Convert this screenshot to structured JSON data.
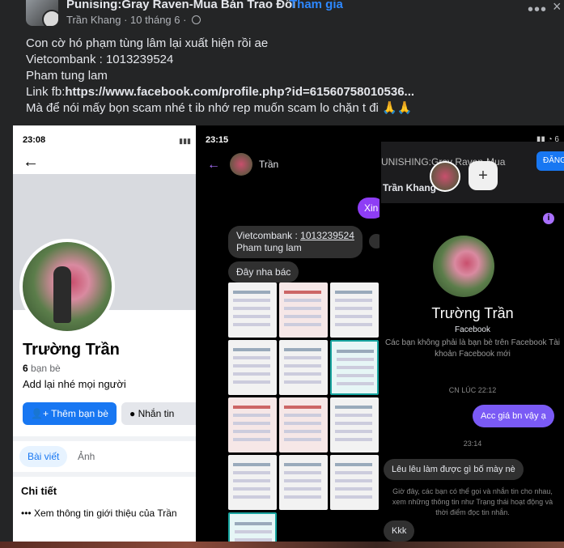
{
  "post": {
    "group_name": "Punising:Gray Raven-Mua Bán Trao Đổi",
    "separator": "·",
    "join_label": "Tham gia",
    "author": "Trần Khang",
    "date": "10 tháng 6",
    "meta_sep": "·",
    "more_label": "•••",
    "close_label": "×",
    "lines": {
      "l1": "Con cờ hó phạm tùng lâm lại xuất hiện rồi ae",
      "l2": "Vietcombank : 1013239524",
      "l3": "Pham tung lam",
      "l4_prefix": "Link fb:",
      "l4_link": "https://www.facebook.com/profile.php?id=61560758010536...",
      "l5": "Mà để nói mấy bọn scam nhé t ib nhớ rep muốn scam lo chặn t đi 🙏🙏"
    }
  },
  "photo1": {
    "status_time": "23:08",
    "back_icon": "←",
    "profile_name": "Trường Trần",
    "friends_count": "6",
    "friends_label": "bạn bè",
    "bio": "Add lại nhé mọi người",
    "add_friend_label": "Thêm bạn bè",
    "message_label": "Nhắn tin",
    "tab_posts": "Bài viết",
    "tab_photos": "Ảnh",
    "details_title": "Chi tiết",
    "intro_link": "Xem thông tin giới thiệu của Trần"
  },
  "photo2": {
    "status_time": "23:15",
    "back_icon": "←",
    "chat_name": "Trần",
    "out_message": "Xin",
    "bank_line1": "Vietcombank : ",
    "bank_number": "1013239524",
    "bank_line2": "Pham tung lam",
    "reply": "Đây nha bác"
  },
  "photo3": {
    "group_title": "UNISHING:Gray Raven-Mua",
    "join_label": "ĐĂNG",
    "author": "Trần Khang",
    "plus_label": "+",
    "info_icon": "i",
    "chat_name": "Trường Trần",
    "chat_sub": "Facebook",
    "chat_info": "Các bạn không phải là bạn bè trên Facebook Tài khoản Facebook mới",
    "time1": "CN LÚC 22:12",
    "out_message": "Acc giá bn vậy ạ",
    "time2": "23:14",
    "in_message": "Lêu lêu làm được gì bố mày nè",
    "notice": "Giờ đây, các bạn có thể gọi và nhắn tin cho nhau, xem những thông tin như Trạng thái hoạt động và thời điểm đọc tin nhắn.",
    "in_message2": "Kkk"
  },
  "colors": {
    "background": "#242526",
    "link_blue": "#2d88ff",
    "messenger_purple": "#8e3df5"
  }
}
